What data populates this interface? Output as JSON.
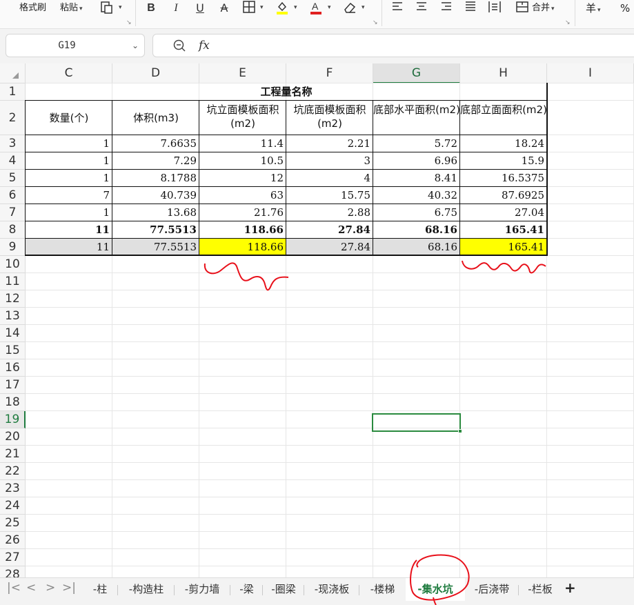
{
  "toolbar": {
    "format_painter": "格式刷",
    "paste": "粘贴",
    "bold": "B",
    "italic": "I",
    "underline": "U",
    "strike": "A",
    "fill_color": "#ffff00",
    "font_color": "#e02020",
    "merge": "合并",
    "currency": "羊",
    "percent": "%"
  },
  "formula_bar": {
    "name_box": "G19",
    "fx": "fx",
    "content": ""
  },
  "columns": [
    "C",
    "D",
    "E",
    "F",
    "G",
    "H",
    "I"
  ],
  "active_column": "G",
  "rows": [
    "1",
    "2",
    "3",
    "4",
    "5",
    "6",
    "7",
    "8",
    "9",
    "10",
    "11",
    "12",
    "13",
    "14",
    "15",
    "16",
    "17",
    "18",
    "19",
    "20",
    "21",
    "22",
    "23",
    "24",
    "25",
    "26",
    "27",
    "28"
  ],
  "active_row": "19",
  "table": {
    "title": "工程量名称",
    "headers": [
      "数量(个)",
      "体积(m3)",
      "坑立面模板面积(m2)",
      "坑底面模板面积(m2)",
      "底部水平面积(m2)",
      "底部立面面积(m2)"
    ],
    "rows": [
      [
        "1",
        "7.6635",
        "11.4",
        "2.21",
        "5.72",
        "18.24"
      ],
      [
        "1",
        "7.29",
        "10.5",
        "3",
        "6.96",
        "15.9"
      ],
      [
        "1",
        "8.1788",
        "12",
        "4",
        "8.41",
        "16.5375"
      ],
      [
        "7",
        "40.739",
        "63",
        "15.75",
        "40.32",
        "87.6925"
      ],
      [
        "1",
        "13.68",
        "21.76",
        "2.88",
        "6.75",
        "27.04"
      ]
    ],
    "total_row": [
      "11",
      "77.5513",
      "118.66",
      "27.84",
      "68.16",
      "165.41"
    ],
    "check_row": [
      "11",
      "77.5513",
      "118.66",
      "27.84",
      "68.16",
      "165.41"
    ],
    "highlight_color": "#ffff00",
    "check_row_bg": "#e0e0e0"
  },
  "sheet_tabs": [
    "-柱",
    "-构造柱",
    "-剪力墙",
    "-梁",
    "-圈梁",
    "-现浇板",
    "-楼梯",
    "-集水坑",
    "-后浇带",
    "-栏板"
  ],
  "active_tab": "-集水坑",
  "add_sheet": "+",
  "annotation_color": "#e8101a"
}
